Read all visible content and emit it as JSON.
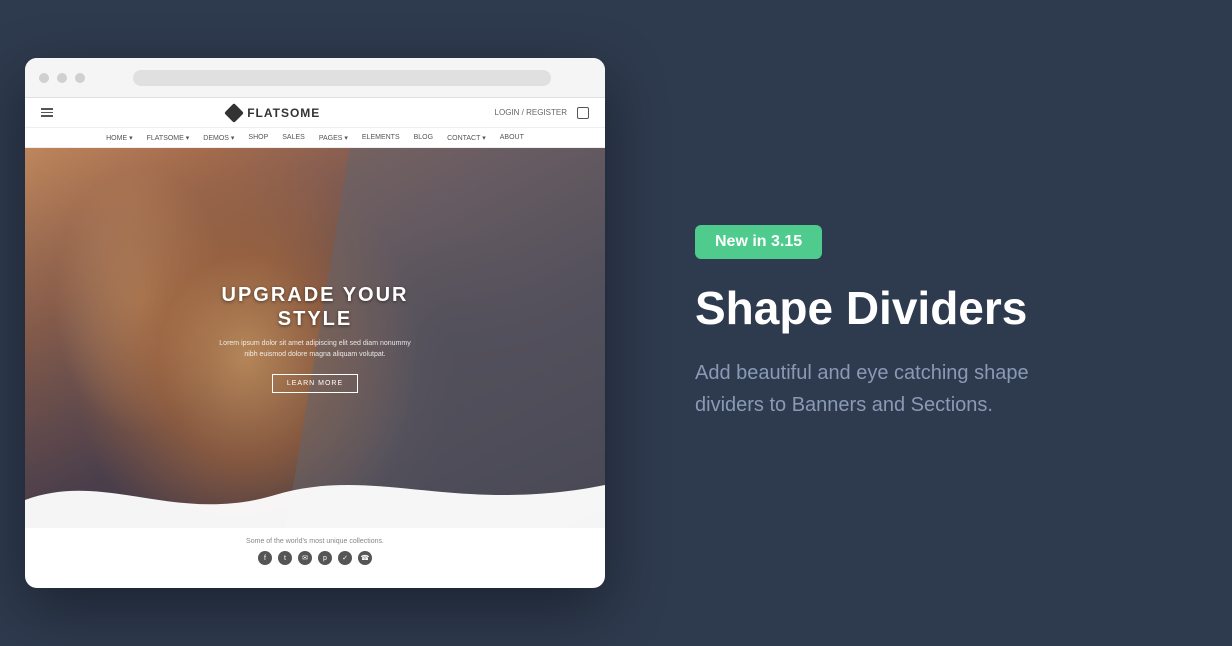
{
  "layout": {
    "background": "#2e3a4e"
  },
  "browser": {
    "nav": {
      "hamburger_label": "menu",
      "logo_text": "FLATSOME",
      "login_label": "LOGIN / REGISTER",
      "nav_links": [
        "HOME",
        "FLATSOME",
        "DEMOS",
        "SHOP",
        "SALES",
        "PAGES",
        "ELEMENTS",
        "BLOG",
        "CONTACT",
        "ABOUT"
      ]
    },
    "hero": {
      "title": "UPGRADE YOUR\nSTYLE",
      "subtitle": "Lorem ipsum dolor sit amet adipiscing elit sed diam nonummy nibh euismod dolore magna aliquam volutpat.",
      "button_label": "LEARN MORE"
    },
    "footer": {
      "text": "Some of the world's most unique collections.",
      "social": [
        "f",
        "t",
        "✉",
        "p",
        "✓",
        "☎"
      ]
    }
  },
  "right": {
    "badge": "New  in 3.15",
    "title": "Shape Dividers",
    "description": "Add beautiful and eye catching shape dividers to Banners and Sections.",
    "badge_color": "#4ecb8d"
  }
}
